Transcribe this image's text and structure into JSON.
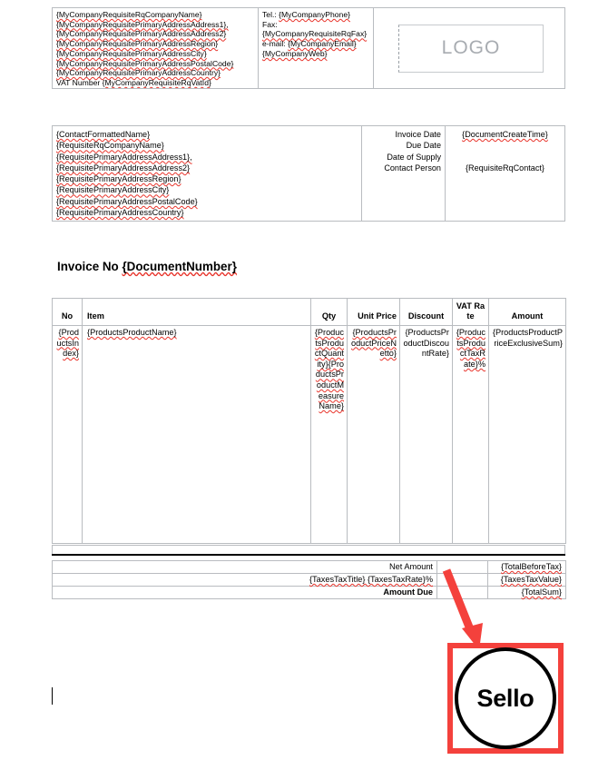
{
  "company_header": {
    "address_lines": [
      "{MyCompanyRequisiteRqCompanyName}",
      "{MyCompanyRequisitePrimaryAddressAddress1},",
      "{MyCompanyRequisitePrimaryAddressAddress2}",
      "{MyCompanyRequisitePrimaryAddressRegion}",
      "{MyCompanyRequisitePrimaryAddressCity}",
      "{MyCompanyRequisitePrimaryAddressPostalCode}",
      "{MyCompanyRequisitePrimaryAddressCountry}"
    ],
    "vat_label": "VAT Number",
    "vat_value": "{MyCompanyRequisiteRqVatId}",
    "tel_label": "Tel.:",
    "tel_value": "{MyCompanyPhone}",
    "fax_label": "Fax:",
    "fax_value": "{MyCompanyRequisiteRqFax}",
    "email_label": "e-mail:",
    "email_value": "{MyCompanyEmail}",
    "web_value": "{MyCompanyWeb}",
    "logo_placeholder": "LOGO"
  },
  "recipient": {
    "lines": [
      "{ContactFormattedName}",
      "{RequisiteRqCompanyName}",
      "{RequisitePrimaryAddressAddress1},",
      "{RequisitePrimaryAddressAddress2}",
      "{RequisitePrimaryAddressRegion}",
      "{RequisitePrimaryAddressCity}",
      "{RequisitePrimaryAddressPostalCode}",
      "{RequisitePrimaryAddressCountry}"
    ]
  },
  "dates": {
    "labels": [
      "Invoice Date",
      "Due Date",
      "Date of Supply",
      "Contact Person"
    ],
    "invoice_date_value": "{DocumentCreateTime}",
    "contact_person_value": "{RequisiteRqContact}"
  },
  "invoice_title": {
    "prefix": "Invoice No ",
    "number": "{DocumentNumber}"
  },
  "products_table": {
    "columns": [
      "No",
      "Item",
      "Qty",
      "Unit Price",
      "Discount",
      "VAT Rate",
      "Amount"
    ],
    "rows": [
      {
        "no": "{ProductsIndex}",
        "item": "{ProductsProductName}",
        "qty": "{ProductsProductQuantity}{ProductsProductMeasureName}",
        "unit_price": "{ProductsProductPriceNetto}",
        "discount": "{ProductsProductDiscountRate}",
        "vat_rate": "{ProductsProductTaxRate}%",
        "amount": "{ProductsProductPriceExclusiveSum}"
      }
    ]
  },
  "totals": {
    "net_amount_label": "Net Amount",
    "net_amount_value": "{TotalBeforeTax}",
    "tax_label": "{TaxesTaxTitle} {TaxesTaxRate}%",
    "tax_value": "{TaxesTaxValue}",
    "amount_due_label": "Amount Due",
    "amount_due_value": "{TotalSum}"
  },
  "annotation": {
    "stamp_text": "Sello",
    "arrow_color": "#f4413c",
    "box_border_color": "#f4413c",
    "circle_color": "#000000"
  }
}
